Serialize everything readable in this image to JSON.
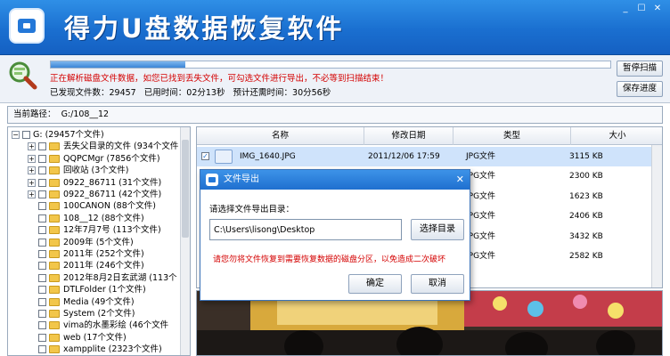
{
  "app": {
    "title": "得力U盘数据恢复软件",
    "window_controls": [
      "_",
      "☐",
      "✕"
    ]
  },
  "scan": {
    "progress": 0.24,
    "message": "正在解析磁盘文件数据，如您已找到丢失文件，可勾选文件进行导出，不必等到扫描结束！",
    "found_label": "已发现文件数：29457",
    "elapsed_label": "已用时间：02分13秒",
    "remaining_label": "预计还需时间：30分56秒",
    "pause_button": "暂停扫描",
    "save_button": "保存进度"
  },
  "path": {
    "label": "当前路径：",
    "value": "G:/108__12"
  },
  "tree": {
    "items": [
      {
        "label": "G: (29457个文件)",
        "level": 0,
        "expander": "−"
      },
      {
        "label": "丢失父目录的文件 (934个文件",
        "level": 1,
        "expander": "+"
      },
      {
        "label": "QQPCMgr (7856个文件)",
        "level": 1,
        "expander": "+"
      },
      {
        "label": "回收站 (3个文件)",
        "level": 1,
        "expander": "+"
      },
      {
        "label": "0922_86711 (31个文件)",
        "level": 1,
        "expander": "+"
      },
      {
        "label": "0922_86711 (42个文件)",
        "level": 1,
        "expander": "+"
      },
      {
        "label": "100CANON (88个文件)",
        "level": 1,
        "expander": ""
      },
      {
        "label": "108__12 (88个文件)",
        "level": 1,
        "expander": ""
      },
      {
        "label": "12年7月7号 (113个文件)",
        "level": 1,
        "expander": ""
      },
      {
        "label": "2009年 (5个文件)",
        "level": 1,
        "expander": ""
      },
      {
        "label": "2011年 (252个文件)",
        "level": 1,
        "expander": ""
      },
      {
        "label": "2011年 (246个文件)",
        "level": 1,
        "expander": ""
      },
      {
        "label": "2012年8月2日玄武湖 (113个",
        "level": 1,
        "expander": ""
      },
      {
        "label": "DTLFolder (1个文件)",
        "level": 1,
        "expander": ""
      },
      {
        "label": "Media (49个文件)",
        "level": 1,
        "expander": ""
      },
      {
        "label": "System (2个文件)",
        "level": 1,
        "expander": ""
      },
      {
        "label": "vima的水墨彩绘 (46个文件",
        "level": 1,
        "expander": ""
      },
      {
        "label": "web (17个文件)",
        "level": 1,
        "expander": ""
      },
      {
        "label": "xampplite (2323个文件)",
        "level": 1,
        "expander": ""
      }
    ]
  },
  "file_list": {
    "headers": [
      "名称",
      "修改日期",
      "类型",
      "大小"
    ],
    "rows": [
      {
        "name": "IMG_1640.JPG",
        "date": "2011/12/06 17:59",
        "type": "JPG文件",
        "size": "3115 KB",
        "selected": true
      },
      {
        "name": "",
        "date": "",
        "type": "JPG文件",
        "size": "2300 KB",
        "selected": false
      },
      {
        "name": "",
        "date": "",
        "type": "JPG文件",
        "size": "1623 KB",
        "selected": false
      },
      {
        "name": "",
        "date": "",
        "type": "JPG文件",
        "size": "2406 KB",
        "selected": false
      },
      {
        "name": "",
        "date": "",
        "type": "JPG文件",
        "size": "3432 KB",
        "selected": false
      },
      {
        "name": "",
        "date": "",
        "type": "JPG文件",
        "size": "2582 KB",
        "selected": false
      }
    ]
  },
  "dialog": {
    "title": "文件导出",
    "close": "✕",
    "prompt": "请选择文件导出目录：",
    "path_value": "C:\\Users\\lisong\\Desktop",
    "browse_button": "选择目录",
    "warning": "请您勿将文件恢复到需要恢复数据的磁盘分区，以免造成二次破坏",
    "ok_button": "确定",
    "cancel_button": "取消"
  },
  "colors": {
    "title_bar": "#1a6fd0",
    "warning_text": "#d40000",
    "selection": "#cfe3fb"
  }
}
